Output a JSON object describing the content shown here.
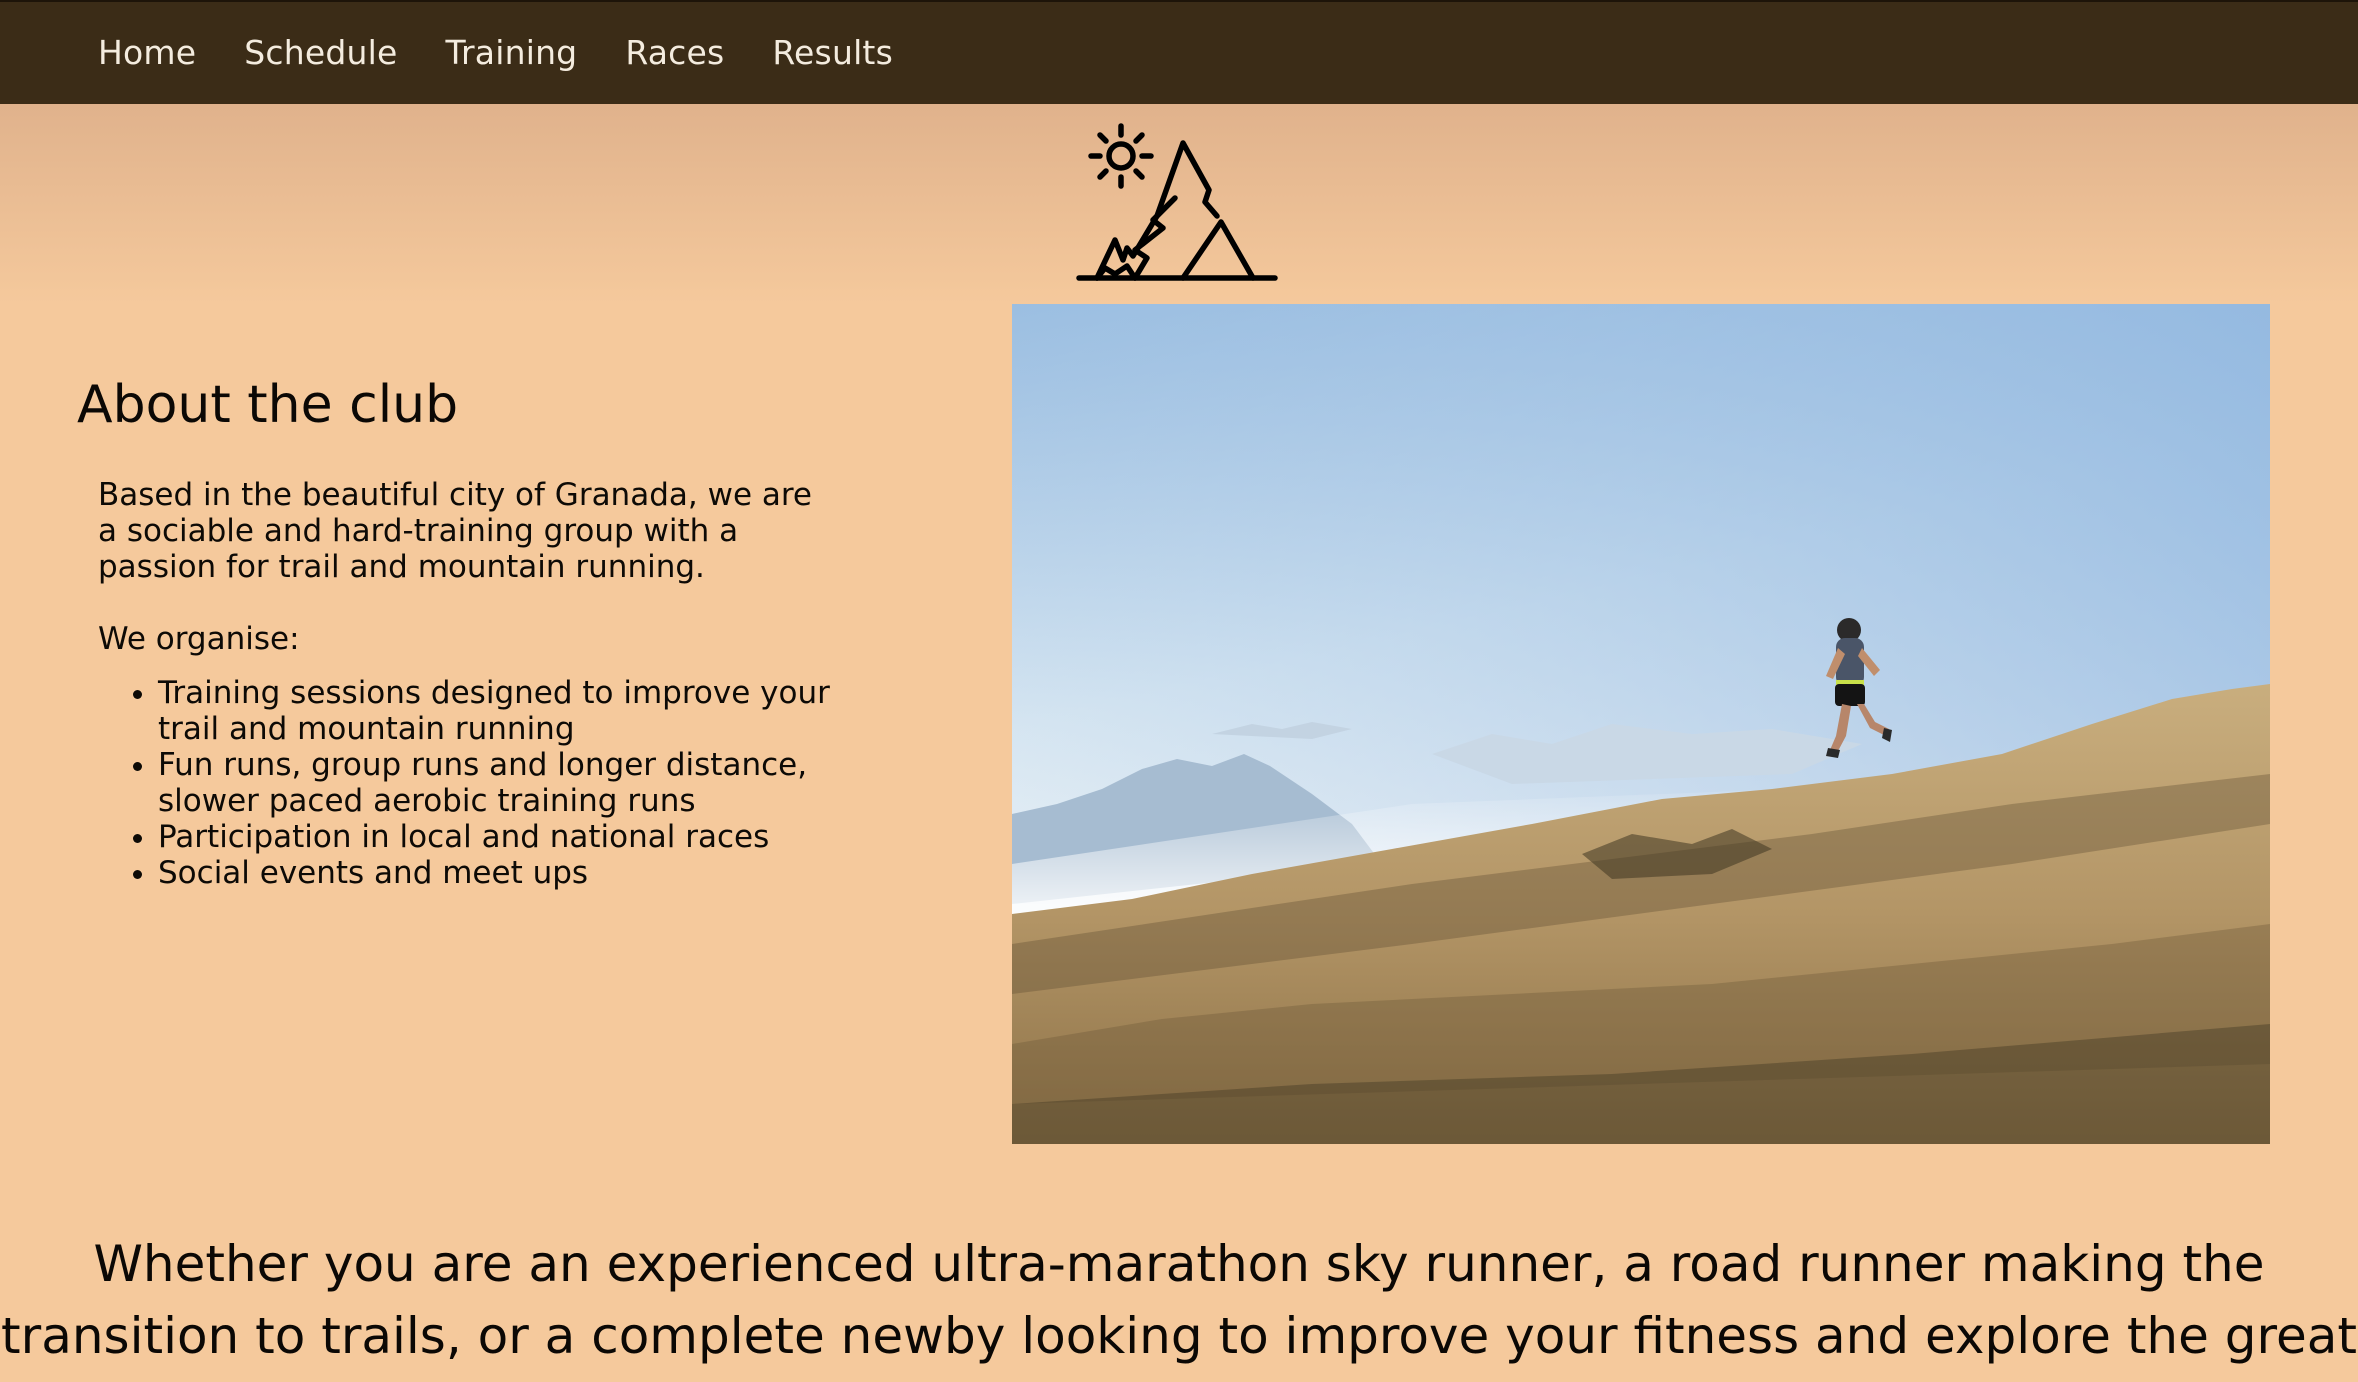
{
  "nav": {
    "items": [
      {
        "label": "Home"
      },
      {
        "label": "Schedule"
      },
      {
        "label": "Training"
      },
      {
        "label": "Races"
      },
      {
        "label": "Results"
      }
    ]
  },
  "logo": {
    "icon": "sun-mountain-icon"
  },
  "about": {
    "title": "About the club",
    "intro": "Based in the beautiful city of Granada, we are a sociable and hard-training group with a passion for trail and mountain running.",
    "organise_label": "We organise:",
    "list": [
      "Training sessions designed to improve your trail and mountain running",
      "Fun runs, group runs and longer distance, slower paced aerobic training runs",
      "Participation in local and national races",
      "Social events and meet ups"
    ]
  },
  "hero_image": {
    "subject": "trail-runner-on-grassy-mountain-ridge"
  },
  "tagline": {
    "line1": "Whether you are an experienced ultra-marathon sky runner, a road runner making the",
    "line2": "transition to trails, or a complete newby looking to improve your fitness and explore the great"
  },
  "colors": {
    "nav_bg": "#3b2c17",
    "page_bg": "#f5c99c",
    "nav_text": "#f4ecdf",
    "text": "#0d0a06"
  }
}
